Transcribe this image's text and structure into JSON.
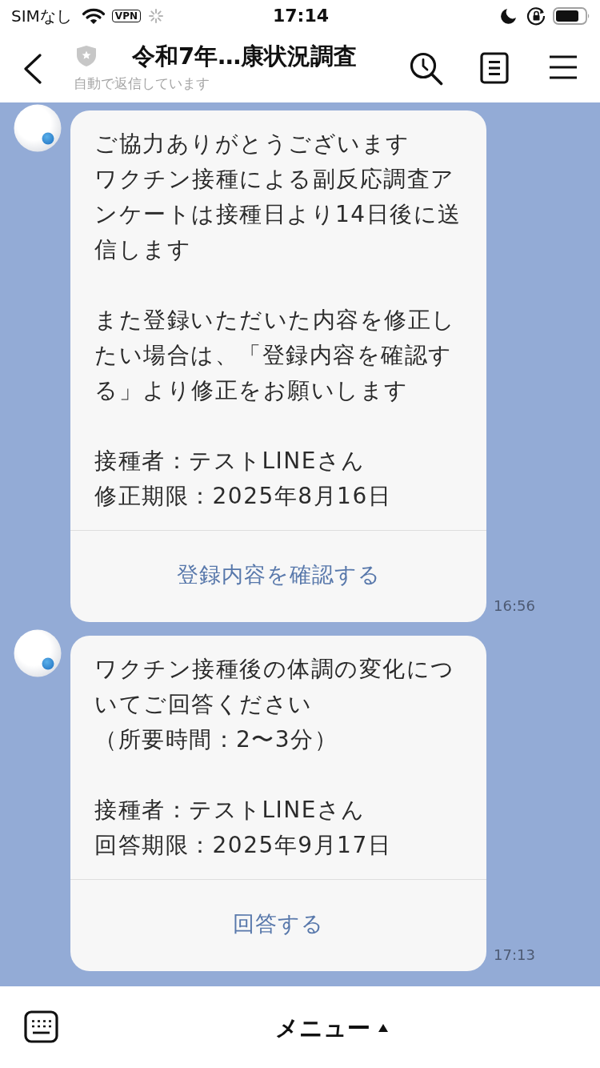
{
  "status_bar": {
    "carrier": "SIMなし",
    "vpn_label": "VPN",
    "time": "17:14"
  },
  "header": {
    "title": "令和7年…康状況調査",
    "subtitle": "自動で返信しています"
  },
  "messages": [
    {
      "paragraphs": [
        [
          "ご協力ありがとうございます",
          "ワクチン接種による副反応調査アンケートは接種日より14日後に送信します"
        ],
        [
          "また登録いただいた内容を修正したい場合は、「登録内容を確認する」より修正をお願いします"
        ],
        [
          "接種者：テストLINEさん",
          "修正期限：2025年8月16日"
        ]
      ],
      "button": "登録内容を確認する",
      "time": "16:56"
    },
    {
      "paragraphs": [
        [
          "ワクチン接種後の体調の変化についてご回答ください",
          "（所要時間：2〜3分）"
        ],
        [
          "接種者：テストLINEさん",
          "回答期限：2025年9月17日"
        ]
      ],
      "button": "回答する",
      "time": "17:13"
    }
  ],
  "bottom_bar": {
    "menu_label": "メニュー"
  }
}
